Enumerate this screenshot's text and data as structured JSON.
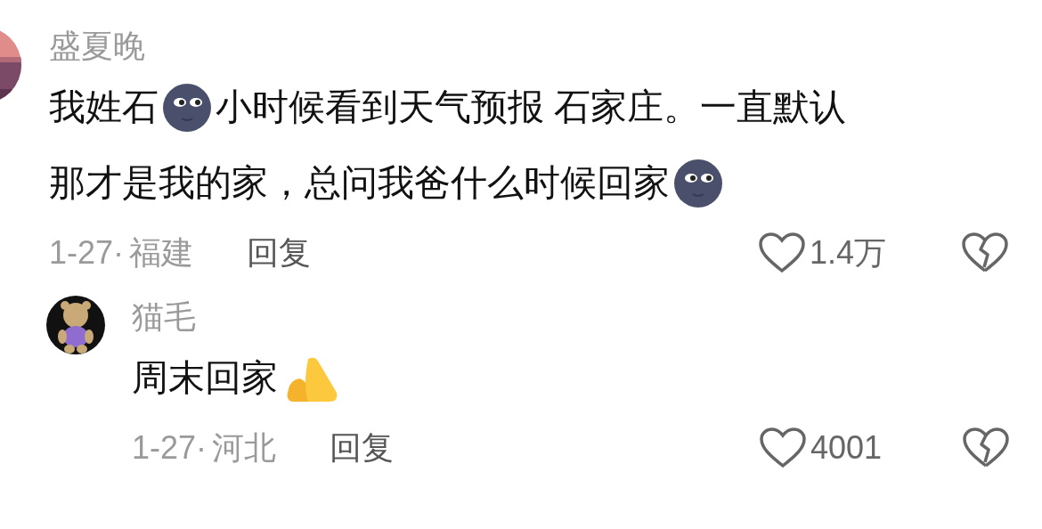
{
  "comments": [
    {
      "username": "盛夏晚",
      "body": [
        [
          {
            "kind": "text",
            "text": "我姓石"
          },
          {
            "kind": "moon"
          },
          {
            "kind": "text",
            "text": "小时候看到天气预报 石家庄。一直默认"
          }
        ],
        [
          {
            "kind": "text",
            "text": "那才是我的家，总问我爸什么时候回家"
          },
          {
            "kind": "moon"
          }
        ]
      ],
      "date": "1-27·",
      "location": "福建",
      "reply_label": "回复",
      "likes": "1.4万",
      "reply": false
    },
    {
      "username": "猫毛",
      "body": [
        [
          {
            "kind": "text",
            "text": "周末回家"
          },
          {
            "kind": "hands"
          }
        ]
      ],
      "date": "1-27·",
      "location": "河北",
      "reply_label": "回复",
      "likes": "4001",
      "reply": true
    }
  ]
}
